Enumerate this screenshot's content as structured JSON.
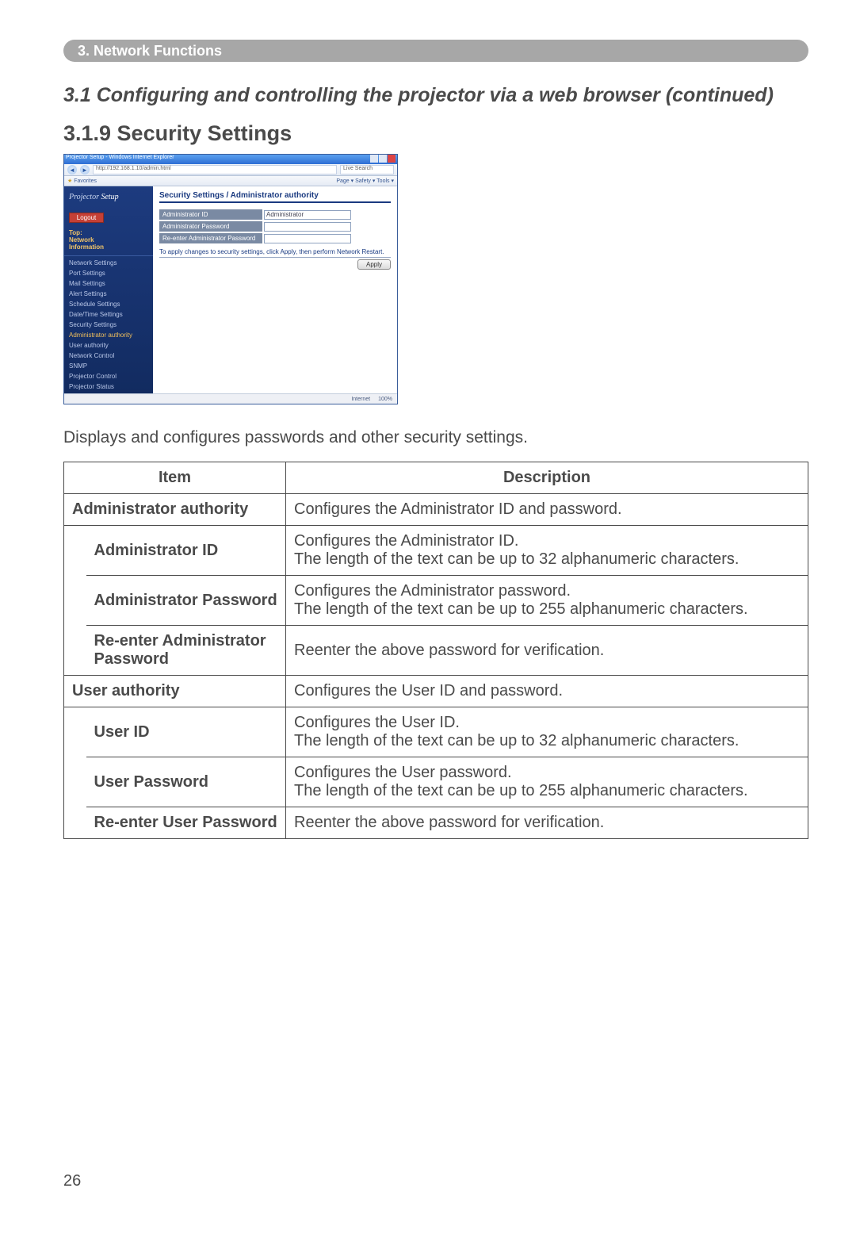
{
  "chapter": "3. Network Functions",
  "sectionTitle": "3.1 Configuring and controlling the projector via a web browser (continued)",
  "subsectionTitle": "3.1.9 Security Settings",
  "lead": "Displays and configures passwords and other security settings.",
  "pageNumber": "26",
  "screenshot": {
    "windowTitle": "Projector Setup - Windows Internet Explorer",
    "address": "http://192.168.1.10/admin.html",
    "searchPlaceholder": "Live Search",
    "favorites": "Favorites",
    "toolsRow": "Page  ▾  Safety  ▾  Tools  ▾",
    "brand1": "Projector",
    "brand2": "Setup",
    "logout": "Logout",
    "sideTop": [
      "Top:",
      "Network",
      "Information"
    ],
    "sideLinks": {
      "network": "Network Settings",
      "port": "Port Settings",
      "mail": "Mail Settings",
      "alert": "Alert Settings",
      "schedule": "Schedule Settings",
      "date": "Date/Time Settings",
      "security": "Security Settings",
      "securitySubs": [
        "Administrator authority",
        "User authority",
        "Network Control",
        "SNMP"
      ],
      "control": "Projector Control",
      "status": "Projector Status"
    },
    "mainHeading": "Security Settings / Administrator authority",
    "fields": {
      "idLabel": "Administrator ID",
      "idValue": "Administrator",
      "pwLabel": "Administrator Password",
      "repwLabel": "Re-enter Administrator Password"
    },
    "note": "To apply changes to security settings, click Apply, then perform Network Restart.",
    "apply": "Apply",
    "statusLeft": "Internet",
    "statusRight": "100%"
  },
  "tableHeaders": {
    "item": "Item",
    "desc": "Description"
  },
  "rows": {
    "adminAuth": {
      "item": "Administrator authority",
      "desc": "Configures the Administrator ID and password."
    },
    "adminId": {
      "item": "Administrator ID",
      "desc": "Configures the Administrator ID.\nThe length of the text can be up to 32 alphanumeric characters."
    },
    "adminPw": {
      "item": "Administrator Password",
      "desc": "Configures the Administrator password.\nThe length of the text can be up to 255 alphanumeric characters."
    },
    "adminRePw": {
      "item": "Re-enter Administrator Password",
      "desc": "Reenter the above password for verification."
    },
    "userAuth": {
      "item": "User authority",
      "desc": "Configures the User ID and password."
    },
    "userId": {
      "item": "User ID",
      "desc": "Configures the User ID.\nThe length of the text can be up to 32 alphanumeric characters."
    },
    "userPw": {
      "item": "User Password",
      "desc": "Configures the User password.\nThe length of the text can be up to 255 alphanumeric characters."
    },
    "userRePw": {
      "item": "Re-enter User Password",
      "desc": "Reenter the above password for verification."
    }
  }
}
